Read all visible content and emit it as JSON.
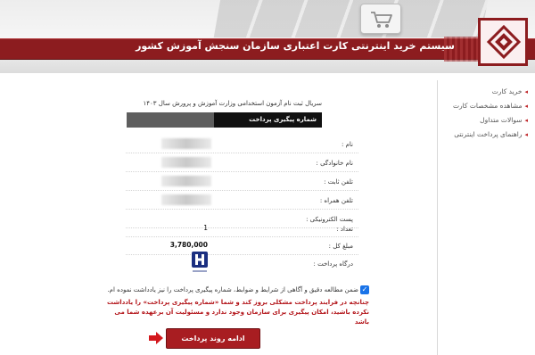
{
  "header": {
    "title": "سیستم خرید اینترنتی کارت اعتباری سازمان سنجش آموزش کشور"
  },
  "sidebar": {
    "items": [
      {
        "label": "خرید کارت"
      },
      {
        "label": "مشاهده مشخصات کارت"
      },
      {
        "label": "سوالات متداول"
      },
      {
        "label": "راهنمای پرداخت اینترنتی"
      }
    ]
  },
  "service": {
    "name": "سریال ثبت نام آزمون استخدامی وزارت آموزش و پرورش سال ۱۴۰۳",
    "tracking_label": "شماره پیگیری پرداخت"
  },
  "form": {
    "name_label": "نام :",
    "family_label": "نام خانوادگی :",
    "phone_label": "تلفن ثابت :",
    "mobile_label": "تلفن همراه :",
    "email_label": "پست الکترونیکی :",
    "count_label": "تعداد :",
    "count_value": "1",
    "total_label": "مبلغ کل :",
    "total_value": "3,780,000",
    "gateway_label": "درگاه پرداخت :"
  },
  "agreement": {
    "text": "ضمن مطالعه دقیق و آگاهی از شرایط و ضوابط، شماره پیگیری پرداخت را نیز یادداشت نموده ام."
  },
  "warning": {
    "text": "چنانچه در فرایند پرداخت مشکلی بروز کند و شما «شماره پیگیری پرداخت» را یادداشت نکرده باشید، امکان پیگیری برای سازمان وجود ندارد و مسئولیت آن برعهده شما می باشد"
  },
  "actions": {
    "continue_label": "ادامه روند پرداخت"
  },
  "colors": {
    "brand": "#8c1c1f",
    "button": "#a81d21",
    "warning": "#b3151a"
  },
  "icons": {
    "cart": "cart-icon",
    "logo": "organization-logo-icon",
    "bank": "bank-logo-icon",
    "arrow": "arrow-right-icon"
  }
}
